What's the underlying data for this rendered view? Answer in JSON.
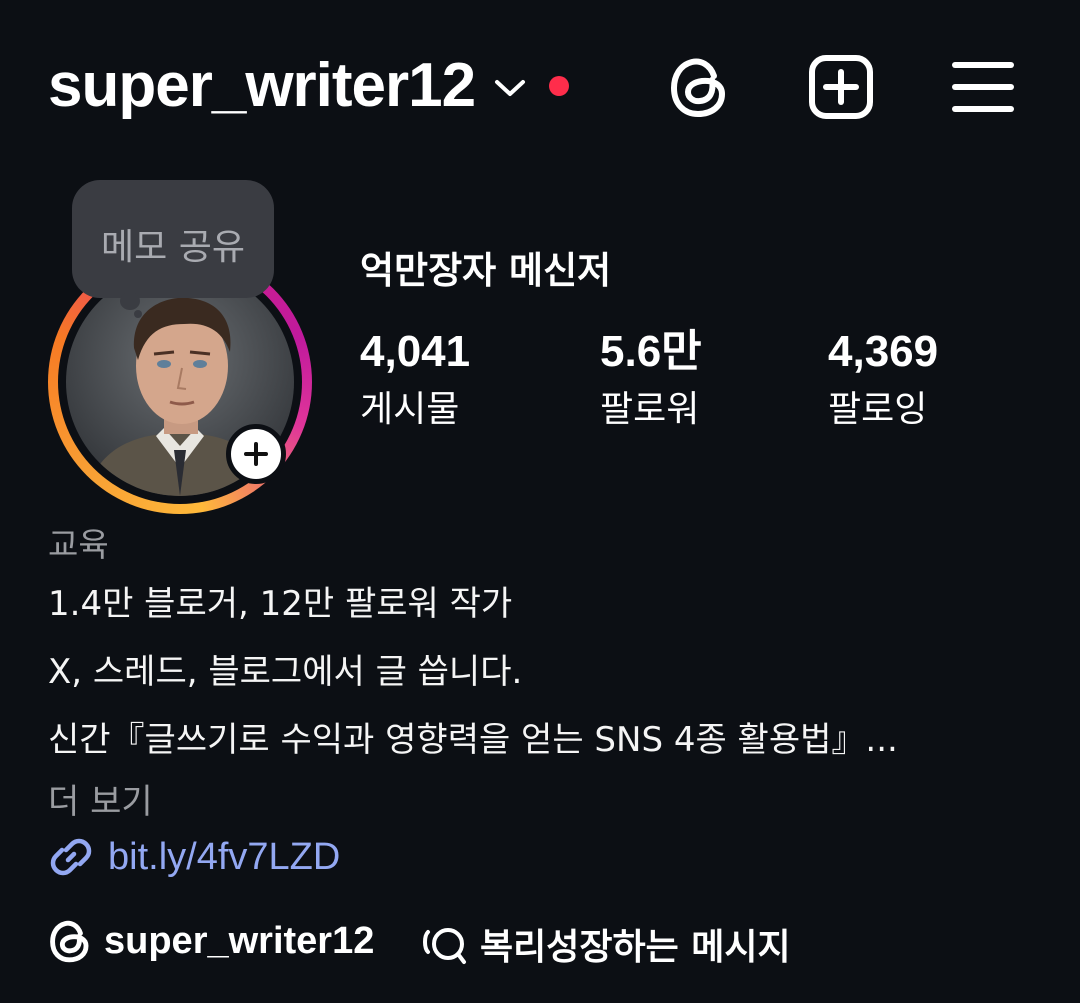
{
  "header": {
    "username": "super_writer12",
    "icons": [
      "chevron-down-icon",
      "threads-icon",
      "add-post-icon",
      "menu-icon"
    ],
    "notification_dot_color": "#ff2d4b"
  },
  "note": {
    "label": "메모 공유"
  },
  "profile": {
    "display_name": "억만장자 메신저",
    "ring_colors": [
      "#d0208a",
      "#ffb93a",
      "#f77a24"
    ],
    "stats": [
      {
        "value": "4,041",
        "label": "게시물"
      },
      {
        "value": "5.6만",
        "label": "팔로워"
      },
      {
        "value": "4,369",
        "label": "팔로잉"
      }
    ]
  },
  "bio": {
    "category": "교육",
    "lines": [
      "1.4만 블로거, 12만 팔로워 작가",
      "X, 스레드, 블로그에서 글 씁니다.",
      "신간『글쓰기로 수익과 영향력을 얻는 SNS 4종 활용법』..."
    ],
    "more_label": "더 보기",
    "link_text": "bit.ly/4fv7LZD",
    "link_color": "#93a8f2"
  },
  "bottom": {
    "threads_handle": "super_writer12",
    "chat_label": "복리성장하는 메시지"
  }
}
